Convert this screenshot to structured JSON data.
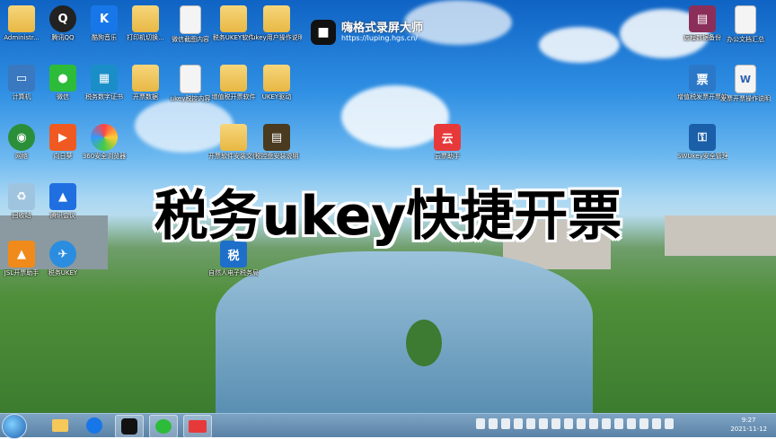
{
  "overlay": {
    "title": "税务ukey快捷开票",
    "watermark_name": "嗨格式录屏大师",
    "watermark_url": "https://luping.hgs.cn/"
  },
  "desktop_icons": [
    {
      "label": "Administr...",
      "icon": "folder-icon"
    },
    {
      "label": "腾讯QQ",
      "icon": "qq-icon"
    },
    {
      "label": "酷狗音乐",
      "icon": "kugou-icon"
    },
    {
      "label": "打印机切换...",
      "icon": "folder-icon"
    },
    {
      "label": "微信截图内容",
      "icon": "document-icon"
    },
    {
      "label": "税务UKEY软件",
      "icon": "folder-icon"
    },
    {
      "label": "ukey用户操作说明",
      "icon": "folder-icon"
    },
    {
      "label": "计算机",
      "icon": "computer-icon"
    },
    {
      "label": "微信",
      "icon": "wechat-icon"
    },
    {
      "label": "税务数字证书",
      "icon": "certificate-icon"
    },
    {
      "label": "开票数据",
      "icon": "folder-icon"
    },
    {
      "label": "ukey税控内容",
      "icon": "document-icon"
    },
    {
      "label": "增值税开票软件",
      "icon": "folder-icon"
    },
    {
      "label": "UKEY驱动",
      "icon": "folder-icon"
    },
    {
      "label": "网络",
      "icon": "network-icon"
    },
    {
      "label": "向日葵",
      "icon": "sunlogin-icon"
    },
    {
      "label": "360安全浏览器",
      "icon": "browser-icon"
    },
    {
      "label": "开票软件安装文件",
      "icon": "folder-icon"
    },
    {
      "label": "税控盘安装说明",
      "icon": "book-icon"
    },
    {
      "label": "云票助手",
      "icon": "yunpiao-icon"
    },
    {
      "label": "回收站",
      "icon": "recycle-bin-icon"
    },
    {
      "label": "腾讯会议",
      "icon": "meeting-icon"
    },
    {
      "label": "JSL开票助手",
      "icon": "invoice-icon"
    },
    {
      "label": "税务UKEY",
      "icon": "ukey-icon"
    },
    {
      "label": "自然人电子税务局",
      "icon": "tax-bureau-icon"
    },
    {
      "label": "远程数据备份",
      "icon": "archive-icon"
    },
    {
      "label": "办公文档汇总",
      "icon": "document-icon"
    },
    {
      "label": "增值税发票开票软件",
      "icon": "invoice-app-icon"
    },
    {
      "label": "发票开票操作说明",
      "icon": "word-icon"
    },
    {
      "label": "SWUkey安全管理工具",
      "icon": "key-icon"
    }
  ],
  "taskbar": {
    "apps": [
      "explorer-icon",
      "kugou-icon",
      "recorder-icon",
      "wechat-icon",
      "yunpiao-icon"
    ],
    "clock_time": "9:27",
    "clock_date": "2021-11-12"
  }
}
